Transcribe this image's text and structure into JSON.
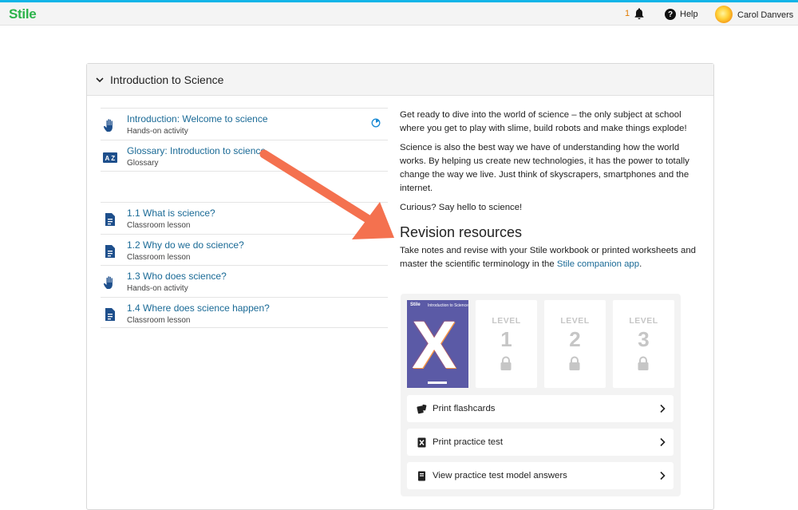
{
  "header": {
    "logo": "Stile",
    "notification_count": "1",
    "help_label": "Help",
    "user_name": "Carol Danvers"
  },
  "unit": {
    "title": "Introduction to Science"
  },
  "lessons": [
    {
      "title": "Introduction: Welcome to science",
      "type": "Hands-on activity",
      "icon": "hand-icon"
    },
    {
      "title": "Glossary: Introduction to science",
      "type": "Glossary",
      "icon": "glossary-az-icon"
    },
    {
      "title": "1.1 What is science?",
      "type": "Classroom lesson",
      "icon": "document-icon"
    },
    {
      "title": "1.2 Why do we do science?",
      "type": "Classroom lesson",
      "icon": "document-icon"
    },
    {
      "title": "1.3 Who does science?",
      "type": "Hands-on activity",
      "icon": "hand-icon"
    },
    {
      "title": "1.4 Where does science happen?",
      "type": "Classroom lesson",
      "icon": "document-icon"
    }
  ],
  "intro": {
    "p1": "Get ready to dive into the world of science – the only subject at school where you get to play with slime, build robots and make things explode!",
    "p2": "Science is also the best way we have of understanding how the world works. By helping us create new technologies, it has the power to totally change the way we live. Just think of skyscrapers, smartphones and the internet.",
    "p3": "Curious? Say hello to science!"
  },
  "revision": {
    "title": "Revision resources",
    "text_before": "Take notes and revise with your Stile workbook or printed worksheets and master the scientific terminology in the ",
    "link": "Stile companion app",
    "text_after": ".",
    "book": {
      "logo": "Stile",
      "title": "Introduction to Science",
      "letter": "X"
    },
    "level_label": "LEVEL",
    "levels": [
      "1",
      "2",
      "3"
    ],
    "actions": [
      {
        "label": "Print flashcards",
        "icon": "flashcards-icon"
      },
      {
        "label": "Print practice test",
        "icon": "practice-test-icon"
      },
      {
        "label": "View practice test model answers",
        "icon": "answers-book-icon"
      }
    ]
  },
  "colors": {
    "accent_top": "#10b4e8",
    "logo_green": "#2bb34a",
    "link_blue": "#1a6a96",
    "annotation_arrow": "#f4714f"
  }
}
